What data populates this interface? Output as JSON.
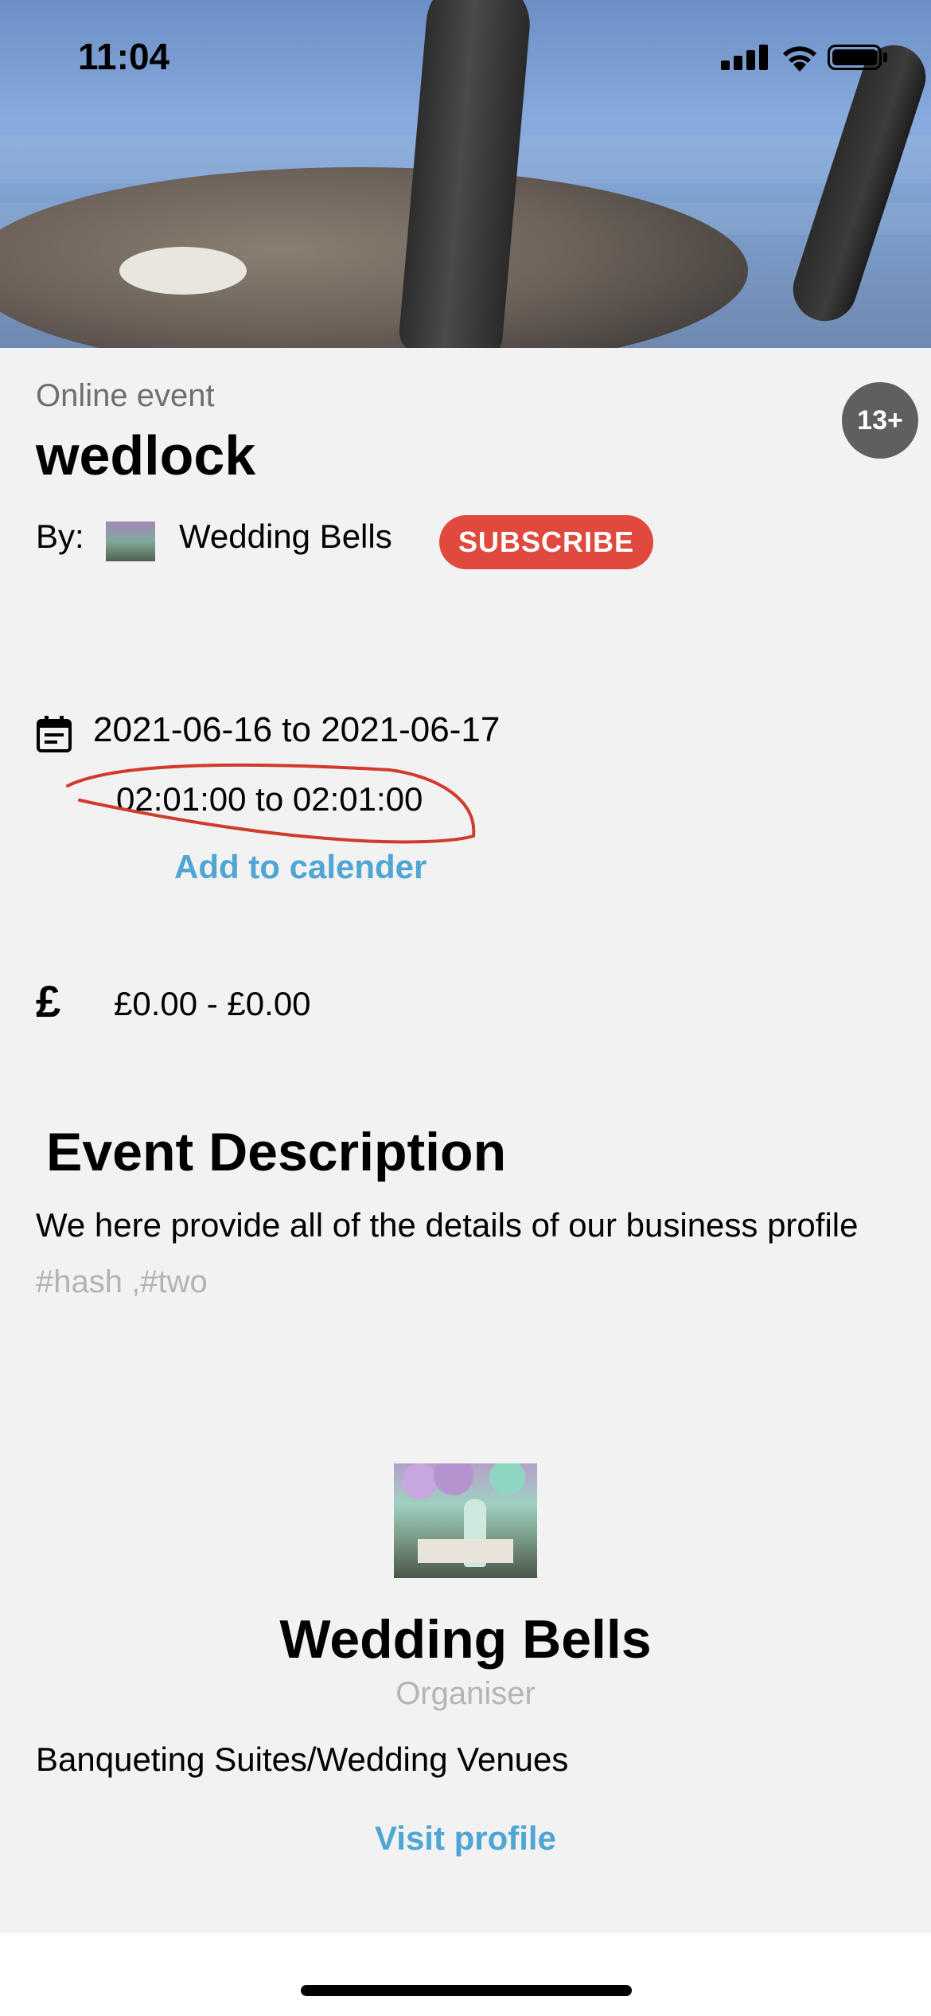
{
  "status_bar": {
    "time": "11:04"
  },
  "event": {
    "type": "Online event",
    "title": "wedlock",
    "age_rating": "13+",
    "by_label": "By:",
    "organiser_name": "Wedding Bells",
    "subscribe_label": "SUBSCRIBE",
    "date_range": "2021-06-16 to 2021-06-17",
    "time_range": "02:01:00 to 02:01:00",
    "add_to_calendar": "Add to calender",
    "currency_icon": "£",
    "price_range": "£0.00  -  £0.00"
  },
  "description": {
    "heading": "Event Description",
    "text": "We here provide all of the details of our business profile",
    "tags": "#hash ,#two"
  },
  "organiser": {
    "name": "Wedding Bells",
    "role": "Organiser",
    "category": "Banqueting Suites/Wedding Venues",
    "visit_label": "Visit profile"
  },
  "colors": {
    "subscribe": "#e0493e",
    "link": "#4fa6d3",
    "badge": "#5f5f5f",
    "annotation": "#d13a2c"
  }
}
